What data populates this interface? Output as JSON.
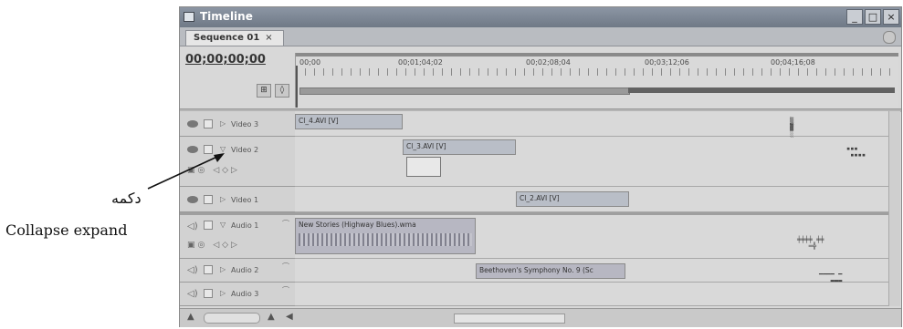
{
  "annotation": {
    "persian_label": "دکمه",
    "english_label": "Collapse expand"
  },
  "window": {
    "title": "Timeline",
    "minimize_glyph": "_",
    "maximize_glyph": "□",
    "close_glyph": "×"
  },
  "tabs": [
    {
      "label": "Sequence 01",
      "close": "×"
    }
  ],
  "timecode": "00;00;00;00",
  "ruler": {
    "labels": [
      "00;00",
      "00;01;04;02",
      "00;02;08;04",
      "00;03;12;06",
      "00;04;16;08"
    ]
  },
  "tracks": [
    {
      "name": "Video 3",
      "type": "video",
      "expanded": false
    },
    {
      "name": "Video 2",
      "type": "video",
      "expanded": true
    },
    {
      "name": "Video 1",
      "type": "video",
      "expanded": false
    },
    {
      "name": "Audio 1",
      "type": "audio",
      "expanded": true
    },
    {
      "name": "Audio 2",
      "type": "audio",
      "expanded": false
    },
    {
      "name": "Audio 3",
      "type": "audio",
      "expanded": false
    }
  ],
  "clips": {
    "video3": "Cl_4.AVI [V]",
    "video2": "Cl_3.AVI [V]",
    "video1": "Cl_2.AVI [V]",
    "audio1": "New Stories (Highway Blues).wma",
    "audio2": "Beethoven's Symphony No. 9 (Sc"
  },
  "colors": {
    "titlebar": "#7f8996",
    "panel_bg": "#d8d8d8",
    "clip_video": "#b9bec7",
    "clip_audio": "#b7b7c2"
  }
}
